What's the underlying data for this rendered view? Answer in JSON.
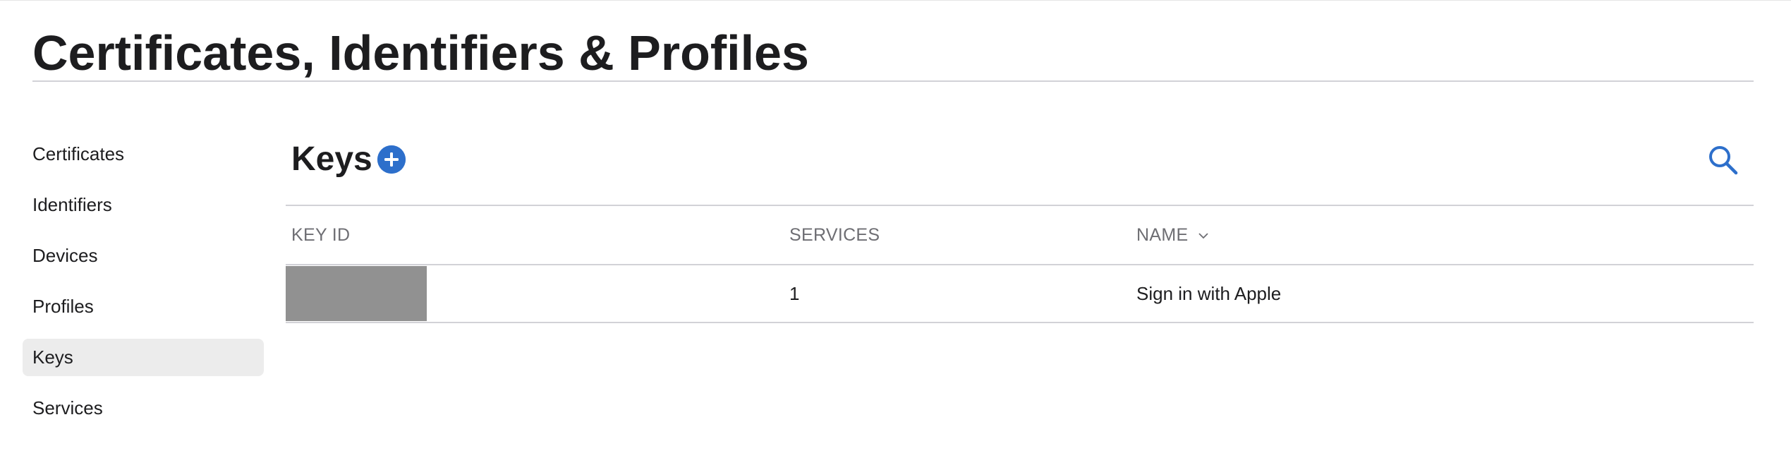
{
  "page": {
    "title": "Certificates, Identifiers & Profiles"
  },
  "sidebar": {
    "items": [
      {
        "label": "Certificates",
        "active": false
      },
      {
        "label": "Identifiers",
        "active": false
      },
      {
        "label": "Devices",
        "active": false
      },
      {
        "label": "Profiles",
        "active": false
      },
      {
        "label": "Keys",
        "active": true
      },
      {
        "label": "Services",
        "active": false
      }
    ]
  },
  "main": {
    "section_title": "Keys",
    "add_icon": "plus-circle-icon",
    "search_icon": "magnifier-icon",
    "table": {
      "columns": [
        "KEY ID",
        "SERVICES",
        "NAME"
      ],
      "sort_icon": "chevron-down-icon",
      "rows": [
        {
          "key_id": "",
          "key_id_redacted": true,
          "services": "1",
          "name": "Sign in with Apple"
        }
      ]
    }
  },
  "colors": {
    "accent": "#2d6fcb",
    "active_item_bg": "#ececec",
    "redaction": "#919191",
    "header_text": "#6e6e73",
    "rule": "#d2d2d7"
  }
}
